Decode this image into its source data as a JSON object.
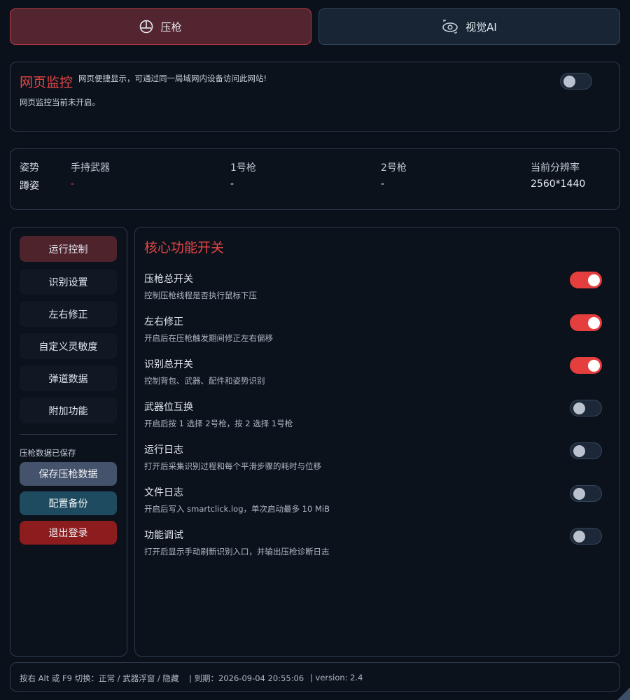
{
  "tabs": [
    {
      "label": "压枪",
      "icon": "crosshair-icon",
      "active": true
    },
    {
      "label": "视觉AI",
      "icon": "eye-ai-icon",
      "active": false
    }
  ],
  "monitor": {
    "title": "网页监控",
    "desc": "网页便捷显示，可通过同一局域网内设备访问此网站!",
    "status": "网页监控当前未开启。",
    "enabled": false
  },
  "status": {
    "posture_label": "姿势",
    "posture_value": "蹲姿",
    "weapon_label": "手持武器",
    "weapon_value": "-",
    "gun1_label": "1号枪",
    "gun1_value": "-",
    "gun2_label": "2号枪",
    "gun2_value": "-",
    "resolution_label": "当前分辨率",
    "resolution_value": "2560*1440"
  },
  "sidebar": {
    "items": [
      {
        "label": "运行控制",
        "active": true
      },
      {
        "label": "识别设置",
        "active": false
      },
      {
        "label": "左右修正",
        "active": false
      },
      {
        "label": "自定义灵敏度",
        "active": false
      },
      {
        "label": "弹道数据",
        "active": false
      },
      {
        "label": "附加功能",
        "active": false
      }
    ],
    "note": "压枪数据已保存",
    "save_label": "保存压枪数据",
    "backup_label": "配置备份",
    "logout_label": "退出登录"
  },
  "main": {
    "title": "核心功能开关",
    "features": [
      {
        "name": "压枪总开关",
        "desc": "控制压枪线程是否执行鼠标下压",
        "on": true
      },
      {
        "name": "左右修正",
        "desc": "开启后在压枪触发期间修正左右偏移",
        "on": true
      },
      {
        "name": "识别总开关",
        "desc": "控制背包、武器、配件和姿势识别",
        "on": true
      },
      {
        "name": "武器位互换",
        "desc": "开启后按 1 选择 2号枪，按 2 选择 1号枪",
        "on": false
      },
      {
        "name": "运行日志",
        "desc": "打开后采集识别过程和每个平滑步骤的耗时与位移",
        "on": false
      },
      {
        "name": "文件日志",
        "desc": "开启后写入 smartclick.log，单次启动最多 10 MiB",
        "on": false
      },
      {
        "name": "功能调试",
        "desc": "打开后显示手动刷新识别入口，并输出压枪诊断日志",
        "on": false
      }
    ]
  },
  "footer": {
    "hotkey": "按右 Alt 或 F9 切换：正常 / 武器浮窗 / 隐藏",
    "expiry": "| 到期：2026-09-04 20:55:06",
    "version": "| version: 2.4"
  },
  "colors": {
    "accent_red": "#e53e3e",
    "background": "#0b111b",
    "border": "#2c3a4b"
  }
}
